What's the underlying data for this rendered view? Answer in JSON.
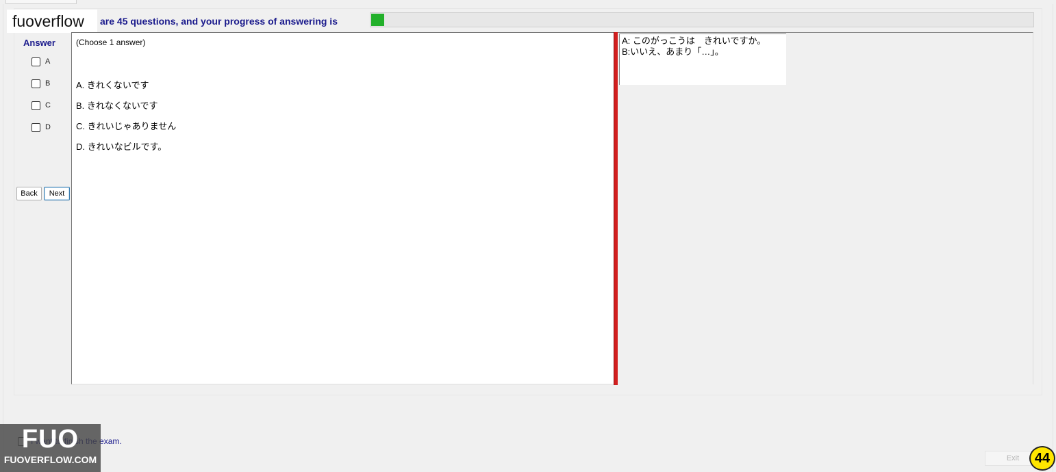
{
  "brand": {
    "label": "fuoverflow"
  },
  "header": {
    "progress_text": "are 45 questions, and your progress of answering is",
    "progress_fraction": 0.02
  },
  "answer": {
    "title": "Answer",
    "options": [
      "A",
      "B",
      "C",
      "D"
    ]
  },
  "nav": {
    "back_label": "Back",
    "next_label": "Next"
  },
  "question": {
    "instruction": "(Choose 1 answer)",
    "choices": [
      "A.  きれくないです",
      "B.  きれなくないです",
      "C.  きれいじゃありません",
      "D.  きれいなビルです。"
    ]
  },
  "passage": {
    "line1": "A: このがっこうは　きれいですか。",
    "line2": "B:いいえ、あまり「…」。"
  },
  "footer": {
    "finish_text": "I want to finish the exam.",
    "exit_label": "Exit",
    "question_number": "44",
    "logo_mark": "FUO",
    "logo_sub": "FUOVERFLOW.COM"
  },
  "colors": {
    "header_text": "#1a1a8c",
    "progress_fill": "#22b02a",
    "divider": "#d21f1f",
    "badge": "#ffe600"
  }
}
